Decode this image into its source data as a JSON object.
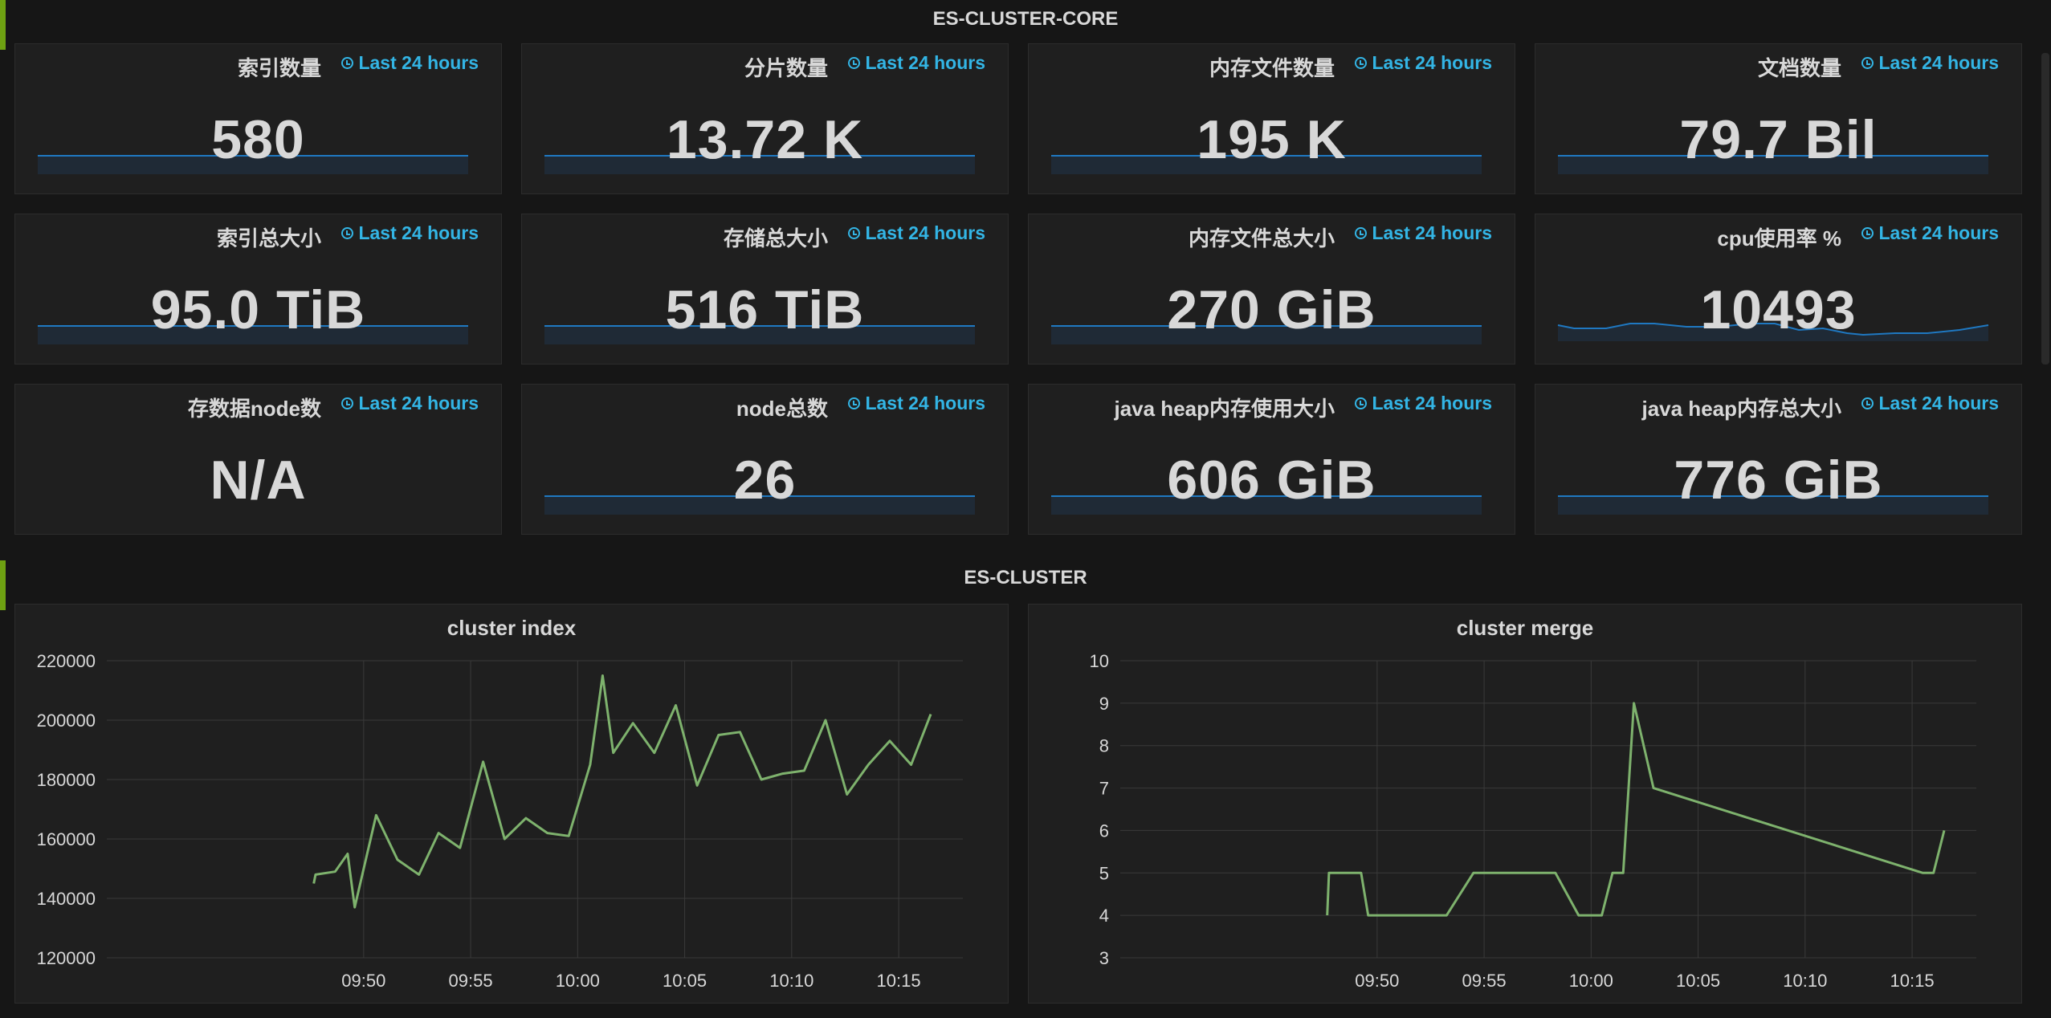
{
  "rows": [
    {
      "title": "ES-CLUSTER-CORE"
    },
    {
      "title": "ES-CLUSTER"
    }
  ],
  "stats": [
    {
      "title": "索引数量",
      "time": "Last 24 hours",
      "value": "580",
      "spark": "flat"
    },
    {
      "title": "分片数量",
      "time": "Last 24 hours",
      "value": "13.72 K",
      "spark": "flat"
    },
    {
      "title": "内存文件数量",
      "time": "Last 24 hours",
      "value": "195 K",
      "spark": "flat"
    },
    {
      "title": "文档数量",
      "time": "Last 24 hours",
      "value": "79.7 Bil",
      "spark": "flat"
    },
    {
      "title": "索引总大小",
      "time": "Last 24 hours",
      "value": "95.0 TiB",
      "spark": "flat"
    },
    {
      "title": "存储总大小",
      "time": "Last 24 hours",
      "value": "516 TiB",
      "spark": "flat"
    },
    {
      "title": "内存文件总大小",
      "time": "Last 24 hours",
      "value": "270 GiB",
      "spark": "flat"
    },
    {
      "title": "cpu使用率 %",
      "time": "Last 24 hours",
      "value": "10493",
      "spark": "wave"
    },
    {
      "title": "存数据node数",
      "time": "Last 24 hours",
      "value": "N/A",
      "spark": "none"
    },
    {
      "title": "node总数",
      "time": "Last 24 hours",
      "value": "26",
      "spark": "flat"
    },
    {
      "title": "java heap内存使用大小",
      "time": "Last 24 hours",
      "value": "606 GiB",
      "spark": "flat"
    },
    {
      "title": "java heap内存总大小",
      "time": "Last 24 hours",
      "value": "776 GiB",
      "spark": "flat"
    }
  ],
  "colors": {
    "series": "#7eb26d",
    "accent": "#33b5e5",
    "row_marker": "#6ea112",
    "spark": "#1f78c1"
  },
  "chart_data": [
    {
      "type": "line",
      "title": "cluster index",
      "ylim": [
        120000,
        220000
      ],
      "yticks": [
        120000,
        140000,
        160000,
        180000,
        200000,
        220000
      ],
      "xlim": [
        9.6333,
        10.3
      ],
      "xticks": [
        "09:50",
        "09:55",
        "10:00",
        "10:05",
        "10:10",
        "10:15"
      ],
      "grid": true,
      "x": [
        "09:47:40",
        "09:47:45",
        "09:48:40",
        "09:49:15",
        "09:49:35",
        "09:50:35",
        "09:51:35",
        "09:52:35",
        "09:53:30",
        "09:54:30",
        "09:55:35",
        "09:56:35",
        "09:57:35",
        "09:58:35",
        "09:59:35",
        "10:00:35",
        "10:01:10",
        "10:01:40",
        "10:02:35",
        "10:03:35",
        "10:04:35",
        "10:05:35",
        "10:06:35",
        "10:07:35",
        "10:08:35",
        "10:09:35",
        "10:10:35",
        "10:11:35",
        "10:12:35",
        "10:13:35",
        "10:14:35",
        "10:15:35",
        "10:16:30"
      ],
      "values": [
        145000,
        148000,
        149000,
        155000,
        137000,
        168000,
        153000,
        148000,
        162000,
        157000,
        186000,
        160000,
        167000,
        162000,
        161000,
        185000,
        215000,
        189000,
        199000,
        189000,
        205000,
        178000,
        195000,
        196000,
        180000,
        182000,
        183000,
        200000,
        175000,
        185000,
        193000,
        185000,
        202000
      ]
    },
    {
      "type": "line",
      "title": "cluster merge",
      "ylim": [
        3,
        10
      ],
      "yticks": [
        3,
        4,
        5,
        6,
        7,
        8,
        9,
        10
      ],
      "xlim": [
        9.6333,
        10.3
      ],
      "xticks": [
        "09:50",
        "09:55",
        "10:00",
        "10:05",
        "10:10",
        "10:15"
      ],
      "grid": true,
      "x": [
        "09:47:40",
        "09:47:45",
        "09:49:15",
        "09:49:35",
        "09:53:15",
        "09:54:30",
        "09:58:20",
        "09:59:25",
        "10:00:30",
        "10:01:00",
        "10:01:30",
        "10:02:00",
        "10:02:55",
        "10:15:30",
        "10:16:00",
        "10:16:30"
      ],
      "values": [
        4,
        5,
        5,
        4,
        4,
        5,
        5,
        4,
        4,
        5,
        5,
        9,
        7,
        5,
        5,
        6
      ]
    }
  ]
}
